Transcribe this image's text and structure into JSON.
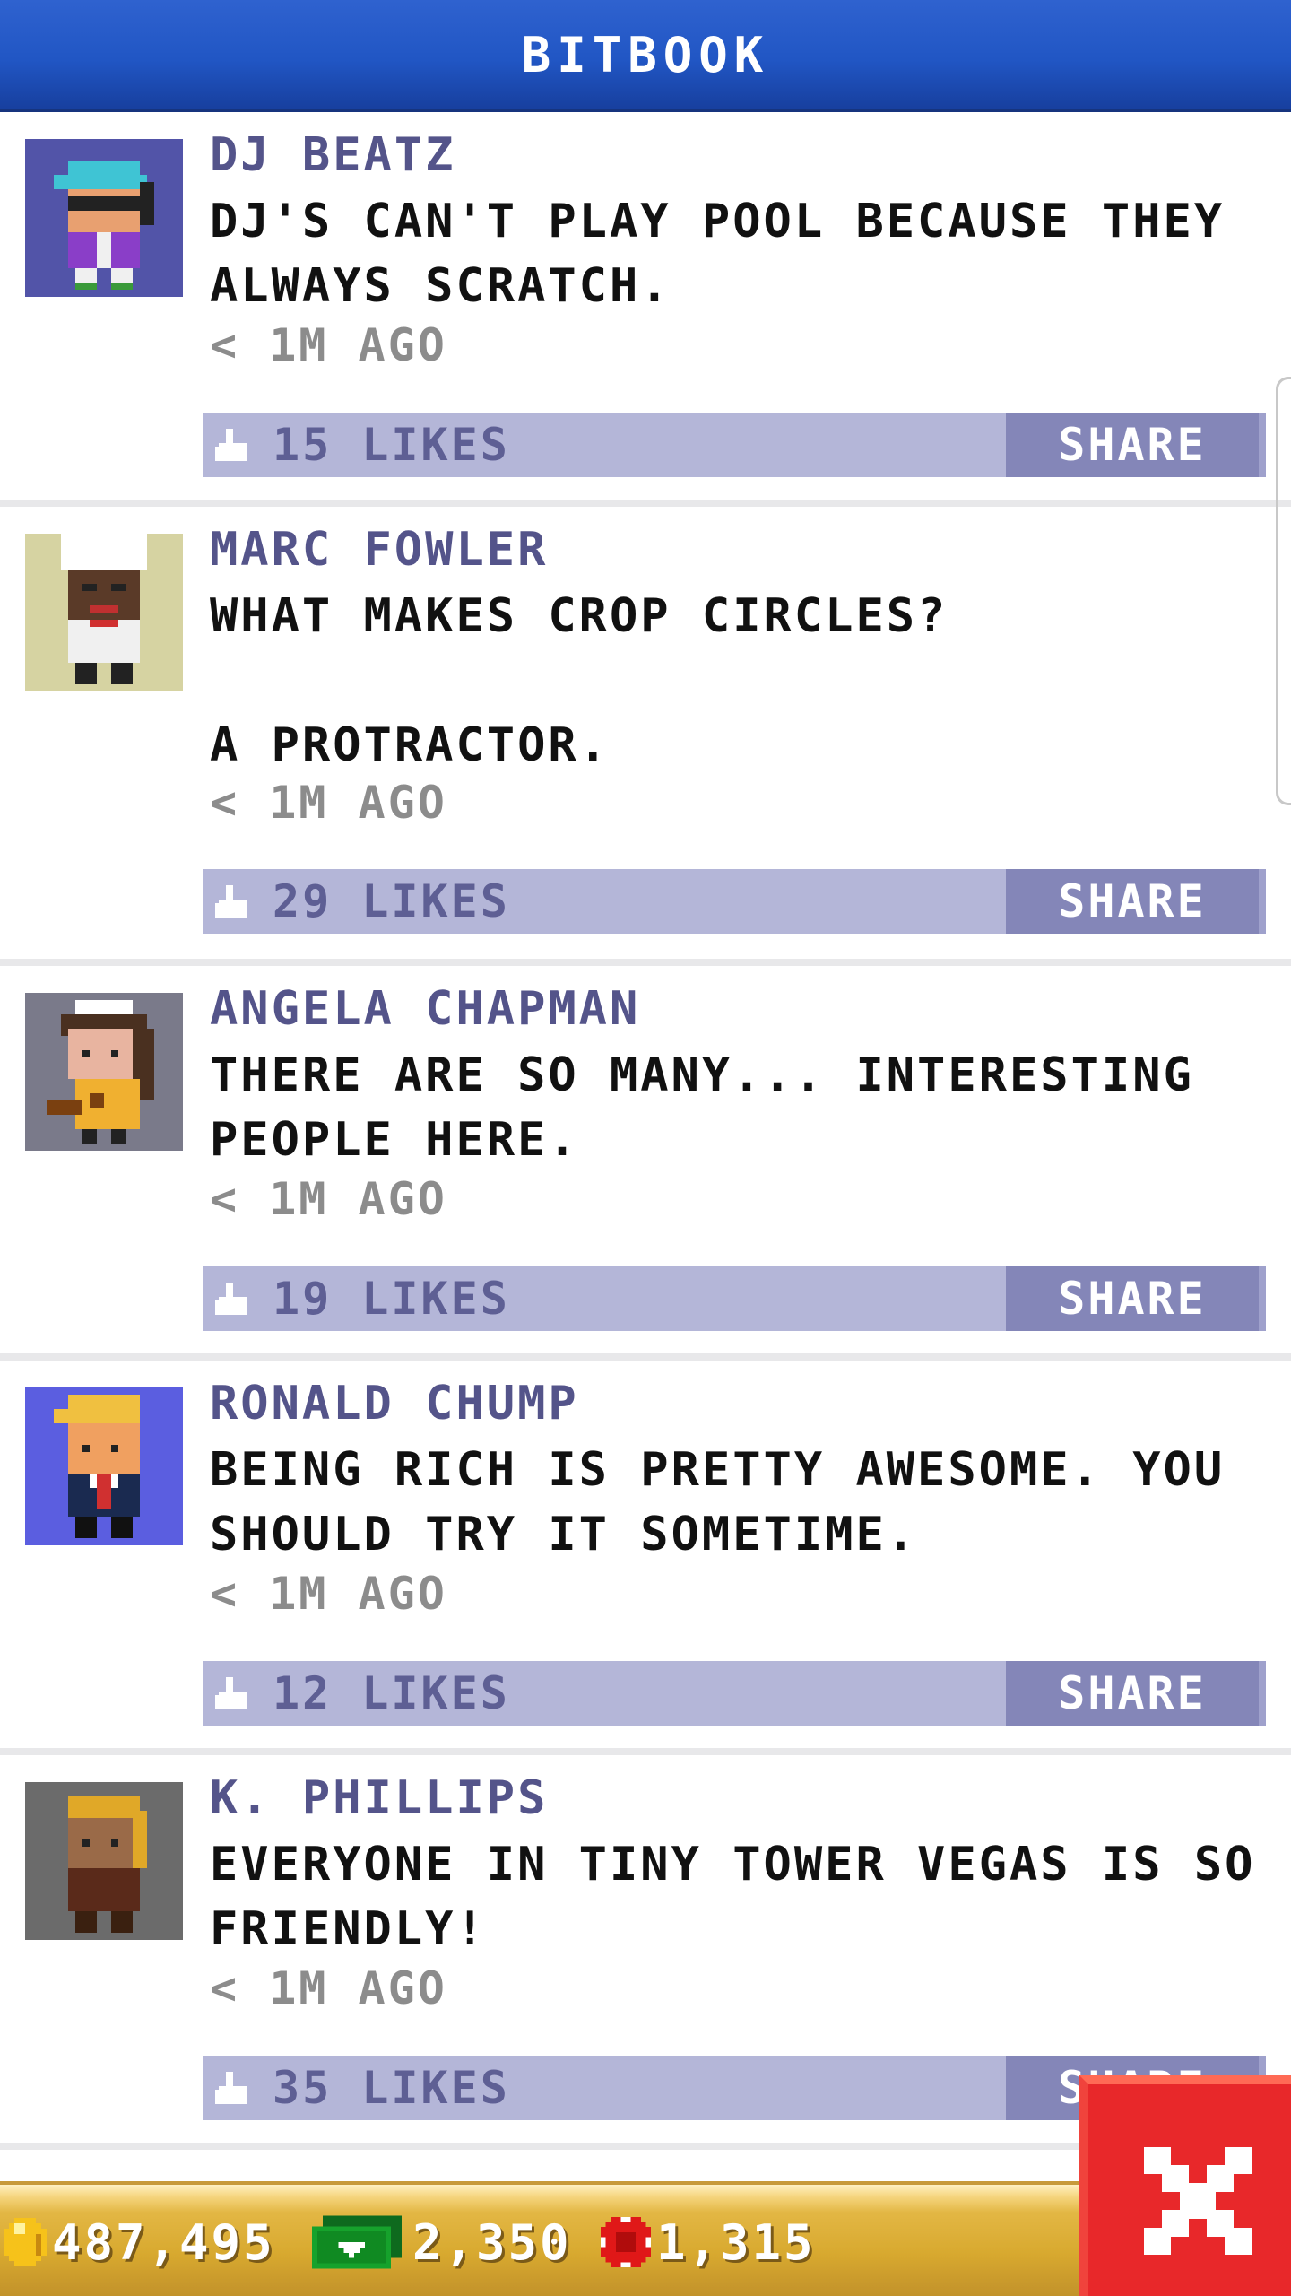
{
  "header": {
    "title": "BITBOOK"
  },
  "posts": [
    {
      "author": "DJ BEATZ",
      "text": "DJ'S CAN'T PLAY POOL BECAUSE THEY ALWAYS SCRATCH.",
      "time": "< 1M AGO",
      "likes": "15 LIKES",
      "share": "SHARE",
      "avatar_bg": "#5254a8"
    },
    {
      "author": "MARC FOWLER",
      "text": "WHAT MAKES CROP CIRCLES?\n\nA PROTRACTOR.",
      "time": "< 1M AGO",
      "likes": "29 LIKES",
      "share": "SHARE",
      "avatar_bg": "#d6d3a2"
    },
    {
      "author": "ANGELA CHAPMAN",
      "text": "THERE ARE SO MANY... INTERESTING PEOPLE HERE.",
      "time": "< 1M AGO",
      "likes": "19 LIKES",
      "share": "SHARE",
      "avatar_bg": "#7a7a8a"
    },
    {
      "author": "RONALD CHUMP",
      "text": "BEING RICH IS PRETTY AWESOME. YOU SHOULD TRY IT SOMETIME.",
      "time": "< 1M AGO",
      "likes": "12 LIKES",
      "share": "SHARE",
      "avatar_bg": "#5b5ee0"
    },
    {
      "author": "K. PHILLIPS",
      "text": "EVERYONE IN TINY TOWER VEGAS IS SO FRIENDLY!",
      "time": "< 1M AGO",
      "likes": "35 LIKES",
      "share": "SHARE",
      "avatar_bg": "#6b6b6b"
    }
  ],
  "currencies": {
    "coins": "487,495",
    "cash": "2,350",
    "chips": "1,315"
  },
  "colors": {
    "header": "#2156c4",
    "action_bar": "#b4b6d8",
    "share_button": "#8486b8",
    "author_text": "#54548a",
    "close_button": "#e8282a"
  }
}
